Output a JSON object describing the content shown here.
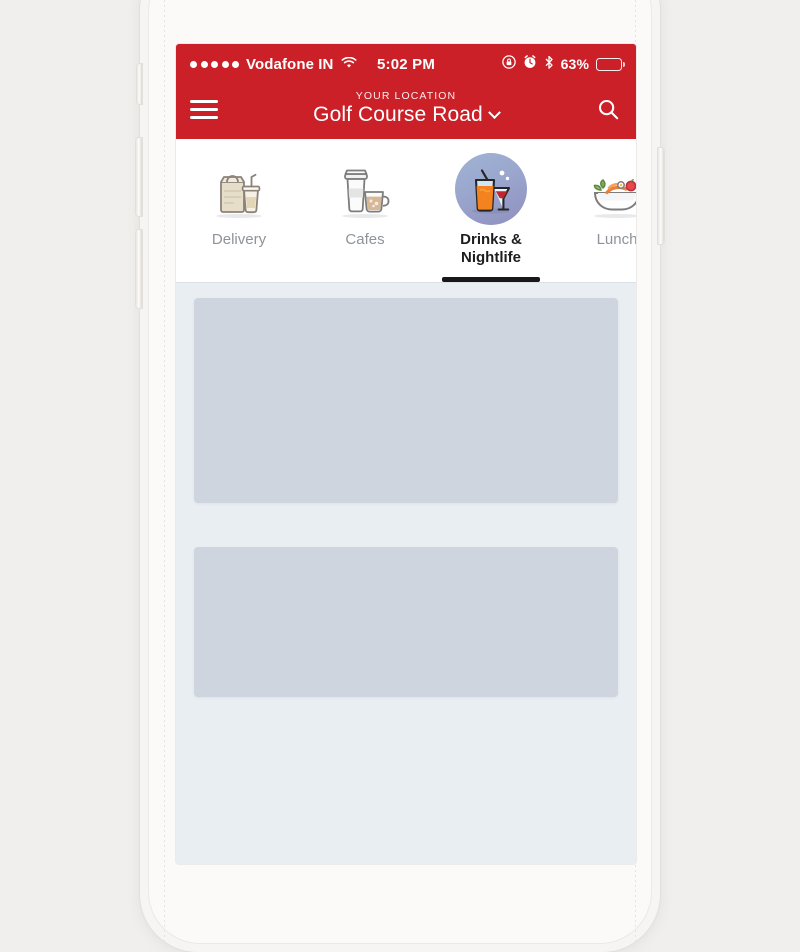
{
  "device": {
    "name": "iphone-mockup",
    "buttons": [
      "silent-switch",
      "volume-up",
      "volume-down",
      "power"
    ]
  },
  "status_bar": {
    "signal_icon": "signal-dots-icon",
    "signal_bars": 5,
    "carrier": "Vodafone IN",
    "wifi_icon": "wifi-icon",
    "time": "5:02 PM",
    "rotation_lock_icon": "rotation-lock-icon",
    "alarm_icon": "alarm-clock-icon",
    "bluetooth_icon": "bluetooth-icon",
    "battery_percent": "63%",
    "battery_fill": 63
  },
  "app_bar": {
    "menu_icon": "hamburger-menu-icon",
    "location_label": "YOUR LOCATION",
    "location_name": "Golf Course Road",
    "chevron_icon": "chevron-down-icon",
    "search_icon": "search-icon",
    "background_color": "#cb2027"
  },
  "tabs": {
    "active_index": 2,
    "items": [
      {
        "label": "Delivery",
        "icon": "delivery-bag-icon",
        "active": false
      },
      {
        "label": "Cafes",
        "icon": "coffee-cups-icon",
        "active": false
      },
      {
        "label": "Drinks &\nNightlife",
        "icon": "drinks-glasses-icon",
        "active": true
      },
      {
        "label": "Lunch",
        "icon": "salad-bowl-icon",
        "active": false
      }
    ],
    "labels": {
      "delivery": "Delivery",
      "cafes": "Cafes",
      "drinks_line1": "Drinks &",
      "drinks_line2": "Nightlife",
      "lunch": "Lunch"
    },
    "active_underline_color": "#18181a",
    "inactive_label_color": "#8d9399"
  },
  "feed": {
    "placeholder_cards": 2,
    "card_color": "#ced5de",
    "background_color": "#e9eef2"
  }
}
